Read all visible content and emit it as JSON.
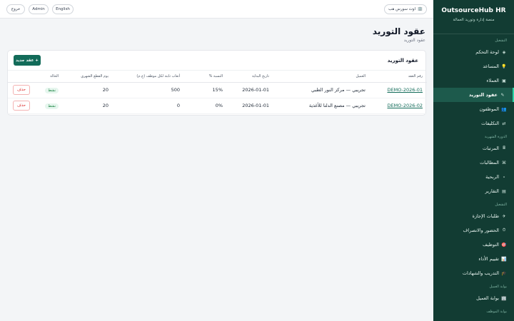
{
  "brand": {
    "title": "OutsourceHub HR",
    "subtitle": "منصة إدارة وتوريد العمالة"
  },
  "topbar": {
    "logout": "خروج",
    "admin": "Admin",
    "language": "English",
    "company": "اوت سورس هب",
    "company_icon": "building-icon"
  },
  "page": {
    "title": "عقود التوريد",
    "breadcrumb": "عقود التوريد"
  },
  "sidebar": {
    "sections": [
      "التشغيل",
      "الدورة الشهرية",
      "التشغيل",
      "بوابة العميل",
      "بوابة الموظف"
    ],
    "items": [
      {
        "icon": "◈",
        "label": "لوحة التحكم"
      },
      {
        "icon": "💡",
        "label": "المساعد"
      },
      {
        "icon": "▣",
        "label": "العملاء"
      },
      {
        "icon": "✎",
        "label": "عقود التوريد"
      },
      {
        "icon": "👥",
        "label": "الموظفون"
      },
      {
        "icon": "⇄",
        "label": "التكليفات"
      },
      {
        "icon": "🖩",
        "label": "المرتبات"
      },
      {
        "icon": "⌘",
        "label": "المطالبات"
      },
      {
        "icon": "⋆",
        "label": "الربحية"
      },
      {
        "icon": "▤",
        "label": "التقارير"
      },
      {
        "icon": "✈",
        "label": "طلبات الإجازة"
      },
      {
        "icon": "⏱",
        "label": "الحضور والانصراف"
      },
      {
        "icon": "🎯",
        "label": "التوظيف"
      },
      {
        "icon": "📊",
        "label": "تقييم الأداء"
      },
      {
        "icon": "🎓",
        "label": "التدريب والشهادات"
      },
      {
        "icon": "🏢",
        "label": "بوابة العميل"
      }
    ]
  },
  "card": {
    "title": "عقود التوريد",
    "new_button": "+ عقد جديد"
  },
  "table": {
    "headers": [
      "رقم العقد",
      "العميل",
      "تاريخ البداية",
      "النسبة %",
      "أتعاب ثابتة لكل موظف (ج.م)",
      "يوم القطع الشهري",
      "الحالة",
      ""
    ],
    "rows": [
      {
        "code": "DEMO-2026-01",
        "client": "تجريبي — مركز النور الطبي",
        "start": "2026-01-01",
        "pct": "15%",
        "fee": "500",
        "cutoff": "20",
        "status": "نشط",
        "action": "حذف"
      },
      {
        "code": "DEMO-2026-02",
        "client": "تجريبي — مصنع الدلتا للأغذية",
        "start": "2026-01-01",
        "pct": "0%",
        "fee": "0",
        "cutoff": "20",
        "status": "نشط",
        "action": "حذف"
      }
    ]
  }
}
